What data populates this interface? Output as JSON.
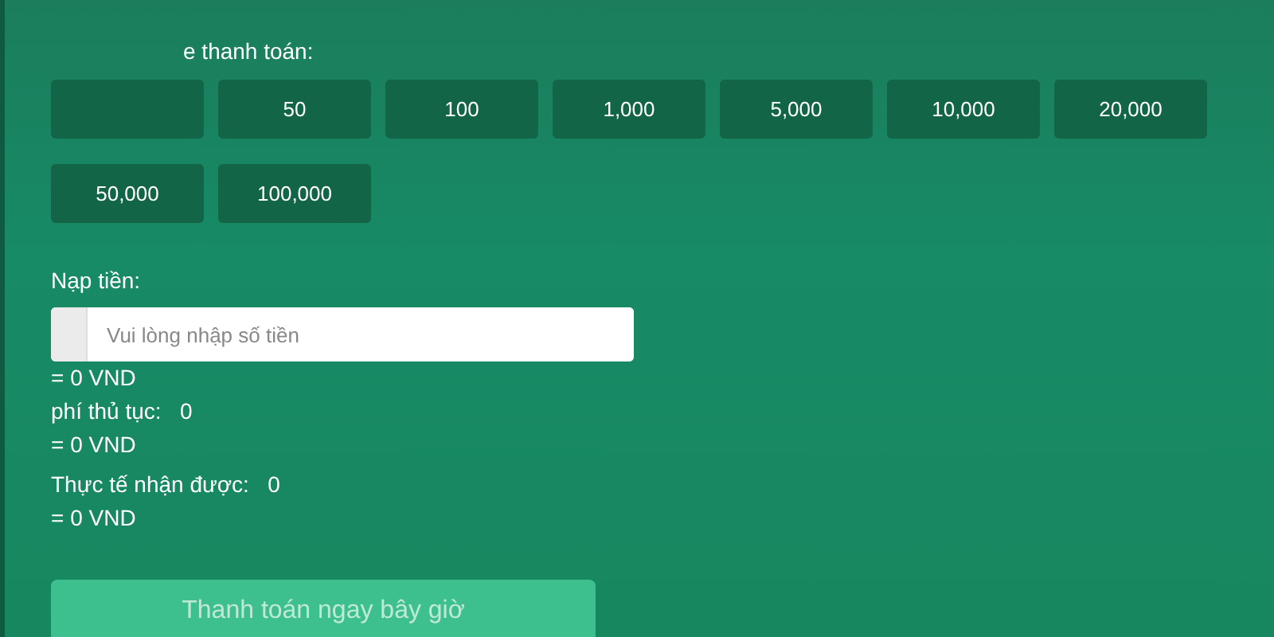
{
  "amount_label": "e thanh toán:",
  "amount_options": [
    {
      "kind": "blank"
    },
    {
      "kind": "amount",
      "label": "50"
    },
    {
      "kind": "amount",
      "label": "100"
    },
    {
      "kind": "amount",
      "label": "1,000"
    },
    {
      "kind": "amount",
      "label": "5,000"
    },
    {
      "kind": "amount",
      "label": "10,000"
    },
    {
      "kind": "amount",
      "label": "20,000"
    },
    {
      "kind": "amount",
      "label": "50,000"
    },
    {
      "kind": "amount",
      "label": "100,000"
    }
  ],
  "deposit": {
    "label": "Nạp tiền:",
    "placeholder": "Vui lòng nhập số tiền",
    "converted": "= 0 VND"
  },
  "fee": {
    "label": "phí thủ tục:",
    "value": "0",
    "converted": "= 0 VND"
  },
  "received": {
    "label": "Thực tế nhận được:",
    "value": "0",
    "converted": "= 0 VND"
  },
  "pay_button": {
    "label": "Thanh toán ngay bây giờ",
    "disabled": true
  }
}
